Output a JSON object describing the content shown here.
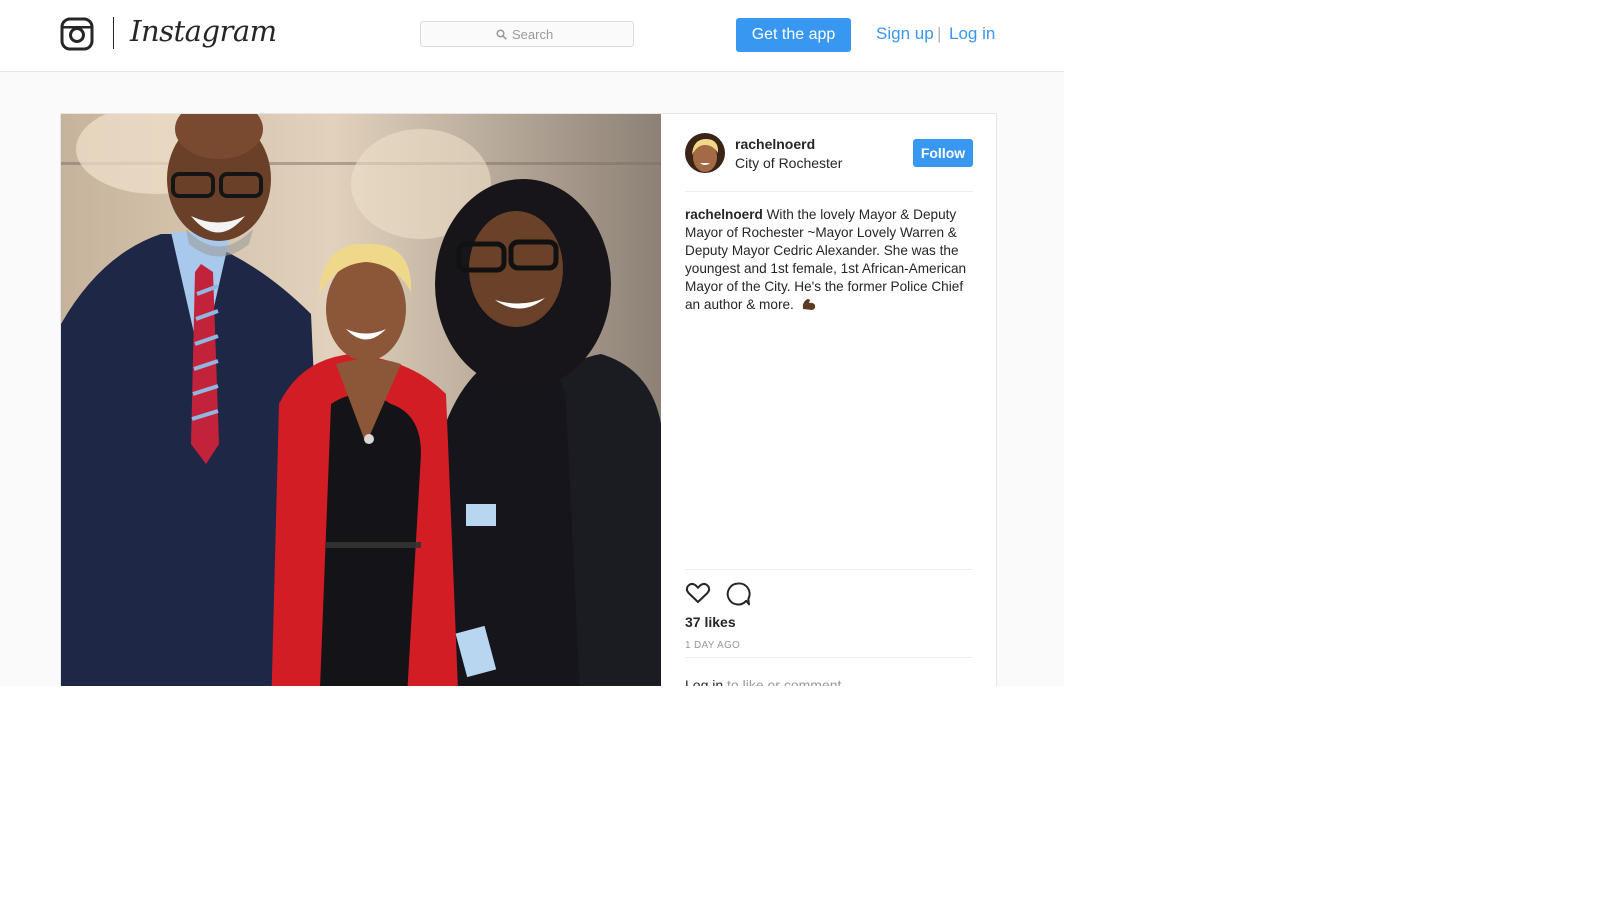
{
  "header": {
    "brand_name": "Instagram",
    "search_placeholder": "Search",
    "get_app_label": "Get the app",
    "signup_label": "Sign up",
    "separator": "|",
    "login_label": "Log in"
  },
  "post": {
    "username": "rachelnoerd",
    "location": "City of Rochester",
    "follow_label": "Follow",
    "caption_user": "rachelnoerd",
    "caption_text": " With the lovely Mayor & Deputy Mayor of Rochester ~Mayor Lovely Warren & Deputy Mayor Cedric Alexander. She was the youngest and 1st female, 1st African-American Mayor of the City. He's the former Police Chief an author & more.",
    "caption_emoji": "flexed-biceps-icon",
    "likes": "37 likes",
    "timestamp": "1 DAY AGO",
    "login_link": "Log in",
    "login_suffix": " to like or comment."
  },
  "colors": {
    "accent": "#3897f0",
    "text": "#262626",
    "muted": "#999999",
    "border": "#e6e6e6",
    "background": "#fafafa"
  }
}
